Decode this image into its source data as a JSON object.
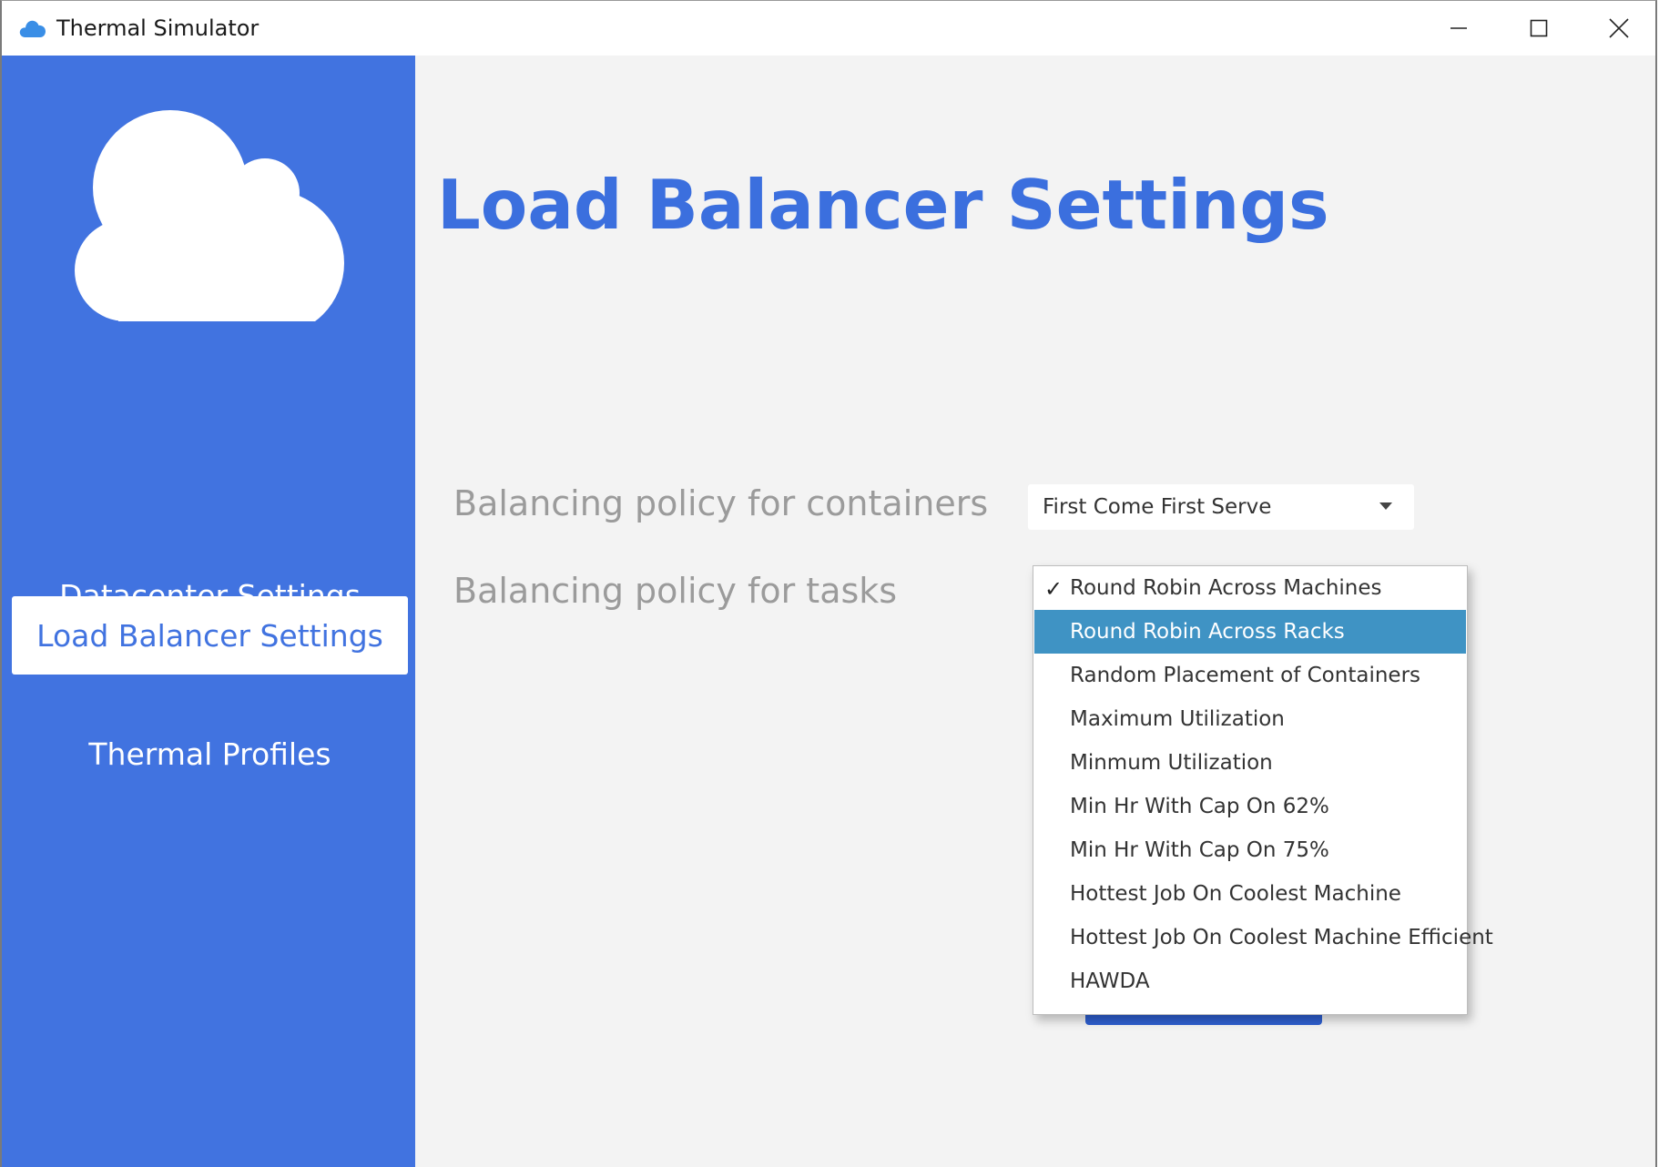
{
  "window": {
    "title": "Thermal Simulator",
    "icon": "cloud-icon"
  },
  "sidebar": {
    "background": "#4173e0",
    "logo": "cloud-icon",
    "items": [
      {
        "label": "Datacenter Settings",
        "active": false
      },
      {
        "label": "Load Balancer Settings",
        "active": true
      },
      {
        "label": "Thermal Profiles",
        "active": false
      }
    ]
  },
  "main": {
    "title": "Load Balancer Settings",
    "accent": "#3b6fde",
    "containers_label": "Balancing policy for containers",
    "containers_value": "First Come First Serve",
    "tasks_label": "Balancing policy for tasks"
  },
  "dropdown": {
    "checked_index": 0,
    "highlighted_index": 1,
    "highlight_color": "#3f93c4",
    "check_glyph": "✓",
    "options": [
      "Round Robin Across Machines",
      "Round Robin Across Racks",
      "Random Placement of Containers",
      "Maximum Utilization",
      "Minmum Utilization",
      "Min Hr With Cap On 62%",
      "Min Hr With Cap On 75%",
      "Hottest Job On Coolest Machine",
      "Hottest Job On Coolest Machine Efficient",
      "HAWDA"
    ]
  }
}
